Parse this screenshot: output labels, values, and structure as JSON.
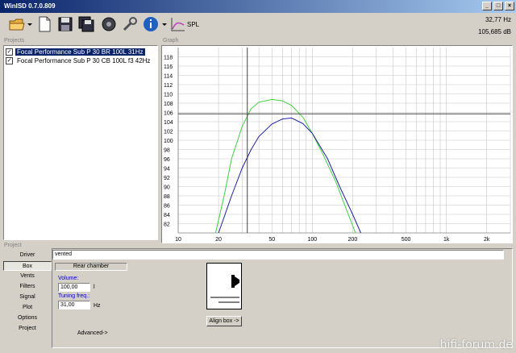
{
  "window": {
    "title": "WinISD 0.7.0.809",
    "buttons": [
      "_",
      "□",
      "×"
    ]
  },
  "toolbar": {
    "items": [
      "open-folder-icon",
      "new-document-icon",
      "save-icon",
      "save-all-icon",
      "driver-icon",
      "wrench-icon",
      "info-icon",
      "spl-graph-icon"
    ],
    "spl_label": "SPL"
  },
  "readout": {
    "frequency": "32,77 Hz",
    "level": "105,685 dB"
  },
  "projects": {
    "label": "Projects",
    "items": [
      {
        "name": "Focal Performance Sub P 30 BR 100L 31Hz",
        "checked": true,
        "selected": true
      },
      {
        "name": "Focal Performance Sub P 30 CB 100L f3 42Hz",
        "checked": true,
        "selected": false
      }
    ]
  },
  "graph": {
    "label": "Graph",
    "cursor": {
      "x": 32.77,
      "y": 105.685
    }
  },
  "chart_data": {
    "type": "line",
    "xscale": "log",
    "xlim": [
      10,
      3000
    ],
    "ylim": [
      80,
      120
    ],
    "xticks": [
      {
        "value": 10,
        "label": "10"
      },
      {
        "value": 20,
        "label": "20"
      },
      {
        "value": 50,
        "label": "50"
      },
      {
        "value": 100,
        "label": "100"
      },
      {
        "value": 200,
        "label": "200"
      },
      {
        "value": 500,
        "label": "500"
      },
      {
        "value": 1000,
        "label": "1k"
      },
      {
        "value": 2000,
        "label": "2k"
      }
    ],
    "yticks": [
      82,
      84,
      86,
      88,
      90,
      92,
      94,
      96,
      98,
      100,
      102,
      104,
      106,
      108,
      110,
      112,
      114,
      116,
      118
    ],
    "grid": true,
    "series": [
      {
        "color": "#40d040",
        "points": [
          [
            19,
            80
          ],
          [
            22,
            88
          ],
          [
            25,
            96
          ],
          [
            30,
            103
          ],
          [
            35,
            106.8
          ],
          [
            40,
            108.2
          ],
          [
            50,
            108.8
          ],
          [
            60,
            108.5
          ],
          [
            70,
            107.5
          ],
          [
            85,
            105
          ],
          [
            100,
            101.5
          ],
          [
            120,
            97
          ],
          [
            150,
            91
          ],
          [
            180,
            85
          ],
          [
            210,
            80
          ]
        ]
      },
      {
        "color": "#2020a0",
        "points": [
          [
            20,
            80
          ],
          [
            25,
            88
          ],
          [
            30,
            94
          ],
          [
            35,
            98
          ],
          [
            40,
            100.8
          ],
          [
            50,
            103.5
          ],
          [
            60,
            104.6
          ],
          [
            70,
            104.8
          ],
          [
            85,
            103.6
          ],
          [
            100,
            101.5
          ],
          [
            130,
            96
          ],
          [
            160,
            90
          ],
          [
            200,
            84
          ],
          [
            230,
            80
          ]
        ]
      }
    ]
  },
  "bottom": {
    "label": "Project",
    "nav": [
      "Driver",
      "Box",
      "Vents",
      "Filters",
      "Signal",
      "Plot",
      "Options",
      "Project"
    ],
    "active_nav": "Box",
    "box_type": "vented",
    "rear_chamber_label": "Rear chamber",
    "volume_label": "Volume:",
    "volume_value": "100,00",
    "volume_unit": "l",
    "tuning_label": "Tuning freq.:",
    "tuning_value": "31,00",
    "tuning_unit": "Hz",
    "advanced_label": "Advanced->",
    "align_label": "Align box ->"
  },
  "watermark": "hifi-forum.de"
}
